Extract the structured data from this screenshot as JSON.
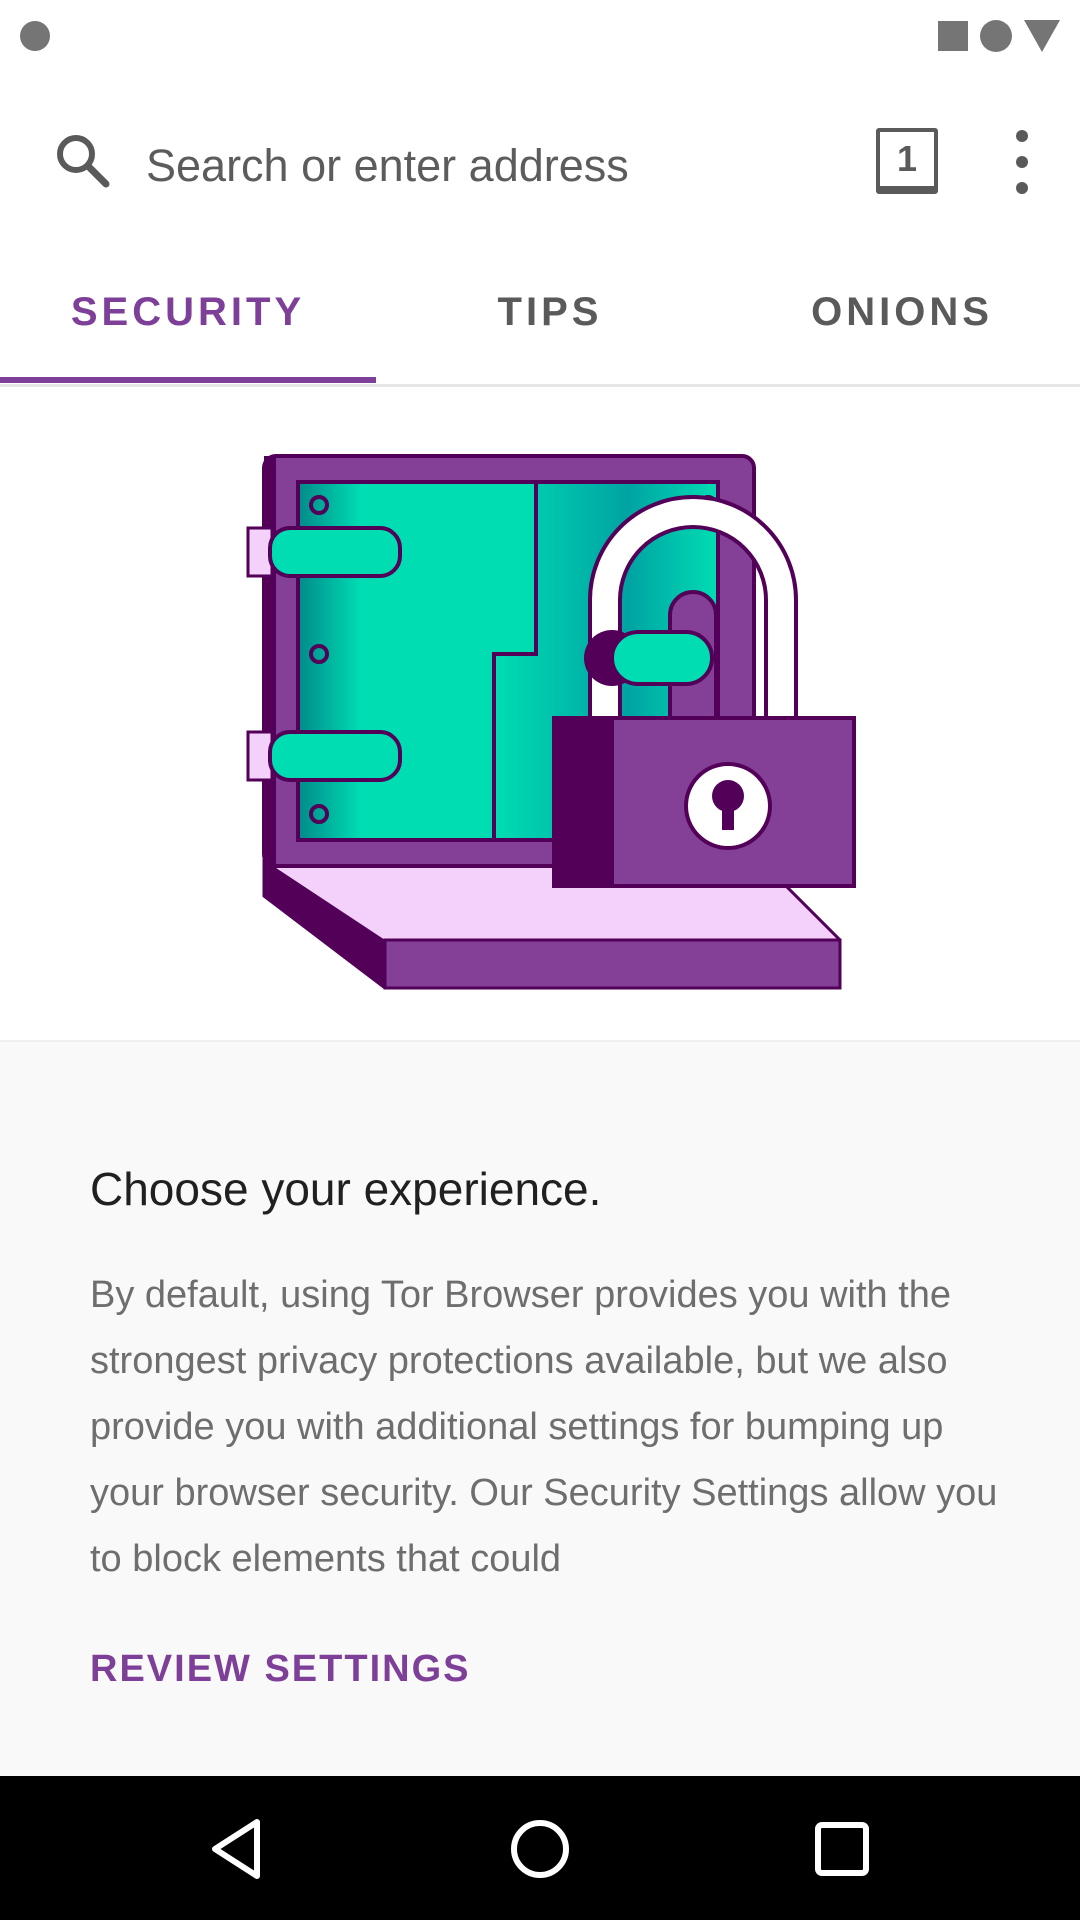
{
  "search": {
    "placeholder": "Search or enter address"
  },
  "tabs_counter": "1",
  "tabs": [
    {
      "label": "SECURITY",
      "active": true
    },
    {
      "label": "TIPS",
      "active": false
    },
    {
      "label": "ONIONS",
      "active": false
    }
  ],
  "card": {
    "title": "Choose your experience.",
    "body": "By default, using Tor Browser provides you with the strongest privacy protections available, but we also provide you with additional settings for bumping up your browser security. Our Security Settings allow you to block elements that could",
    "button": "REVIEW SETTINGS"
  },
  "colors": {
    "accent": "#7d3f98",
    "teal": "#00ddb3",
    "light_purple": "#f3d1fb",
    "dark_purple": "#520058"
  },
  "icons": [
    "search-icon",
    "overflow-menu-icon",
    "nav-back-icon",
    "nav-home-icon",
    "nav-recents-icon"
  ]
}
